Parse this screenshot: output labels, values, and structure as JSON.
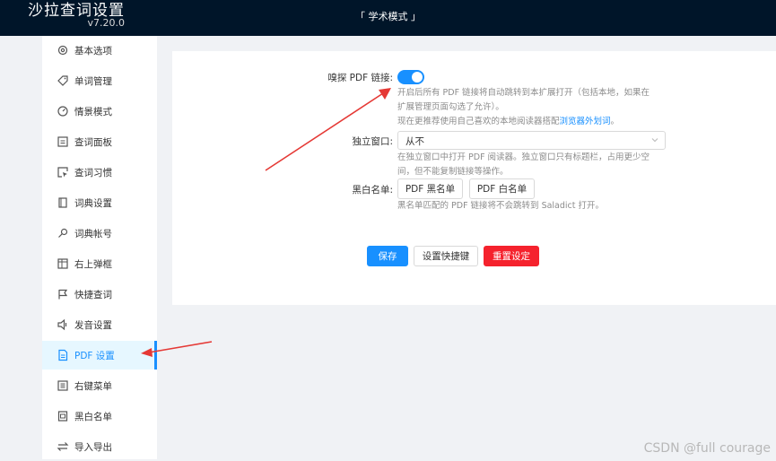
{
  "header": {
    "title": "沙拉查词设置",
    "version": "v7.20.0",
    "mode_label": "「 学术模式 」"
  },
  "sidebar": {
    "items": [
      {
        "label": "基本选项",
        "icon": "gear-icon"
      },
      {
        "label": "单词管理",
        "icon": "tag-icon"
      },
      {
        "label": "情景模式",
        "icon": "dashboard-icon"
      },
      {
        "label": "查词面板",
        "icon": "panel-icon"
      },
      {
        "label": "查词习惯",
        "icon": "cursor-select-icon"
      },
      {
        "label": "词典设置",
        "icon": "book-icon"
      },
      {
        "label": "词典帐号",
        "icon": "key-icon"
      },
      {
        "label": "右上弹框",
        "icon": "layout-icon"
      },
      {
        "label": "快捷查词",
        "icon": "flag-icon"
      },
      {
        "label": "发音设置",
        "icon": "sound-icon"
      },
      {
        "label": "PDF 设置",
        "icon": "file-pdf-icon"
      },
      {
        "label": "右键菜单",
        "icon": "menu-icon"
      },
      {
        "label": "黑白名单",
        "icon": "list-icon"
      },
      {
        "label": "导入导出",
        "icon": "swap-icon"
      }
    ],
    "active_index": 10
  },
  "form": {
    "sniff": {
      "label": "嗅探 PDF 链接:",
      "enabled": true,
      "help1": "开启后所有 PDF 链接将自动跳转到本扩展打开（包括本地，如果在",
      "help2": "扩展管理页面勾选了允许）。",
      "help3_prefix": "现在更推荐使用自己喜欢的本地阅读器搭配",
      "help3_link": "浏览器外划词",
      "help3_suffix": "。"
    },
    "standalone": {
      "label": "独立窗口:",
      "value": "从不",
      "help1": "在独立窗口中打开 PDF 阅读器。独立窗口只有标题栏，占用更少空",
      "help2": "间，但不能复制链接等操作。"
    },
    "lists": {
      "label": "黑白名单:",
      "blacklist_button": "PDF 黑名单",
      "whitelist_button": "PDF 白名单",
      "help": "黑名单匹配的 PDF 链接将不会跳转到 Saladict 打开。"
    }
  },
  "actions": {
    "save": "保存",
    "shortcut": "设置快捷键",
    "reset": "重置设定"
  },
  "watermark": "CSDN @full courage",
  "colors": {
    "header_bg": "#001529",
    "accent": "#1890ff",
    "danger": "#f5222d",
    "annotation_arrow": "#e53935"
  }
}
